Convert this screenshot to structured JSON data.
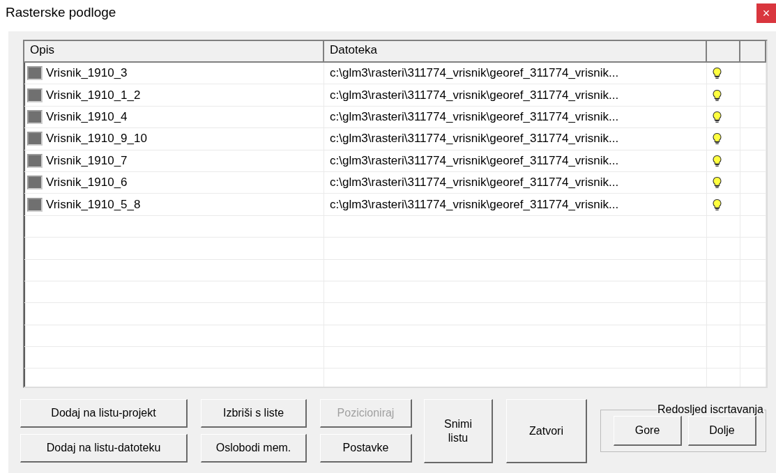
{
  "window": {
    "title": "Rasterske podloge",
    "close": "×"
  },
  "table": {
    "columns": [
      "Opis",
      "Datoteka"
    ],
    "rows": [
      {
        "name": "Vrisnik_1910_3",
        "file": "c:\\glm3\\rasteri\\311774_vrisnik\\georef_311774_vrisnik...",
        "visible": true
      },
      {
        "name": "Vrisnik_1910_1_2",
        "file": "c:\\glm3\\rasteri\\311774_vrisnik\\georef_311774_vrisnik...",
        "visible": true
      },
      {
        "name": "Vrisnik_1910_4",
        "file": "c:\\glm3\\rasteri\\311774_vrisnik\\georef_311774_vrisnik...",
        "visible": true
      },
      {
        "name": "Vrisnik_1910_9_10",
        "file": "c:\\glm3\\rasteri\\311774_vrisnik\\georef_311774_vrisnik...",
        "visible": true
      },
      {
        "name": "Vrisnik_1910_7",
        "file": "c:\\glm3\\rasteri\\311774_vrisnik\\georef_311774_vrisnik...",
        "visible": true
      },
      {
        "name": "Vrisnik_1910_6",
        "file": "c:\\glm3\\rasteri\\311774_vrisnik\\georef_311774_vrisnik...",
        "visible": true
      },
      {
        "name": "Vrisnik_1910_5_8",
        "file": "c:\\glm3\\rasteri\\311774_vrisnik\\georef_311774_vrisnik...",
        "visible": true
      }
    ]
  },
  "buttons_left": [
    {
      "label": "Dodaj na listu-projekt",
      "disabled": false
    },
    {
      "label": "Izbriši s liste",
      "disabled": false
    },
    {
      "label": "Pozicioniraj",
      "disabled": true
    },
    {
      "label": "Dodaj na listu-datoteku",
      "disabled": false
    },
    {
      "label": "Oslobodi mem.",
      "disabled": false
    },
    {
      "label": "Postavke",
      "disabled": false
    }
  ],
  "snimi": "Snimi\nlistu",
  "zatvori": "Zatvori",
  "order_group": {
    "title": "Redosljed iscrtavanja",
    "buttons": [
      "Gore",
      "Dolje"
    ]
  }
}
